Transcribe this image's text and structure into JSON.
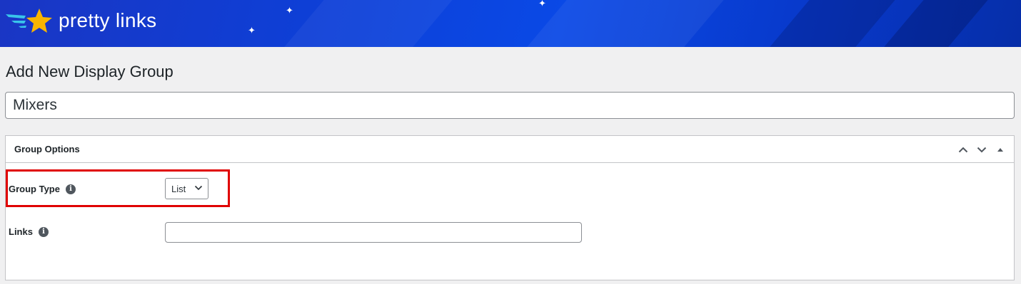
{
  "brand": {
    "name": "pretty links",
    "colors": {
      "banner": "#0a49e6",
      "star": "#f8b500",
      "highlight": "#e00000"
    },
    "icons": [
      "star-logo-icon",
      "sparkle-icon"
    ]
  },
  "page": {
    "title": "Add New Display Group",
    "name_value": "Mixers"
  },
  "group_options": {
    "title": "Group Options",
    "controls": [
      "chevron-up-icon",
      "chevron-down-icon",
      "collapse-triangle-icon"
    ],
    "group_type": {
      "label": "Group Type",
      "selected": "List"
    },
    "links": {
      "label": "Links",
      "value": ""
    }
  }
}
